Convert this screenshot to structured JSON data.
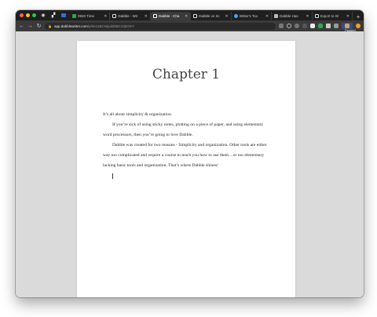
{
  "tabs": [
    {
      "label": "0920 Time",
      "color": "#2fa84f"
    },
    {
      "label": "Dabble - Wri",
      "color": "#ffffff"
    },
    {
      "label": "Dabble - Cha",
      "color": "#ffffff",
      "active": true
    },
    {
      "label": "Dabble vs Sc",
      "color": "#ffffff"
    },
    {
      "label": "Writer's Too",
      "color": "#4aa3ff"
    },
    {
      "label": "Dabble Has",
      "color": "#bbbbbb"
    },
    {
      "label": "Export to W",
      "color": "#ffffff"
    }
  ],
  "address": {
    "domain": "app.dabblewriter.com",
    "path": "/p/0e11BCWjod2kBC22jIOXY"
  },
  "profile": {
    "status": "Paused"
  },
  "document": {
    "title": "Chapter 1",
    "paragraphs": [
      "It’s all about simplicity & organization.",
      "If you’re sick of using sticky notes, plotting on a piece of paper, and using elementary word processors, then you’re going to love Dabble.",
      "Dabble was created for two reasons - Simplicity and organization. Other tools are either way too complicated and require a course to teach you how to use them…or too elementary lacking basic tools and organization. That’s where Dabble shines!"
    ]
  }
}
